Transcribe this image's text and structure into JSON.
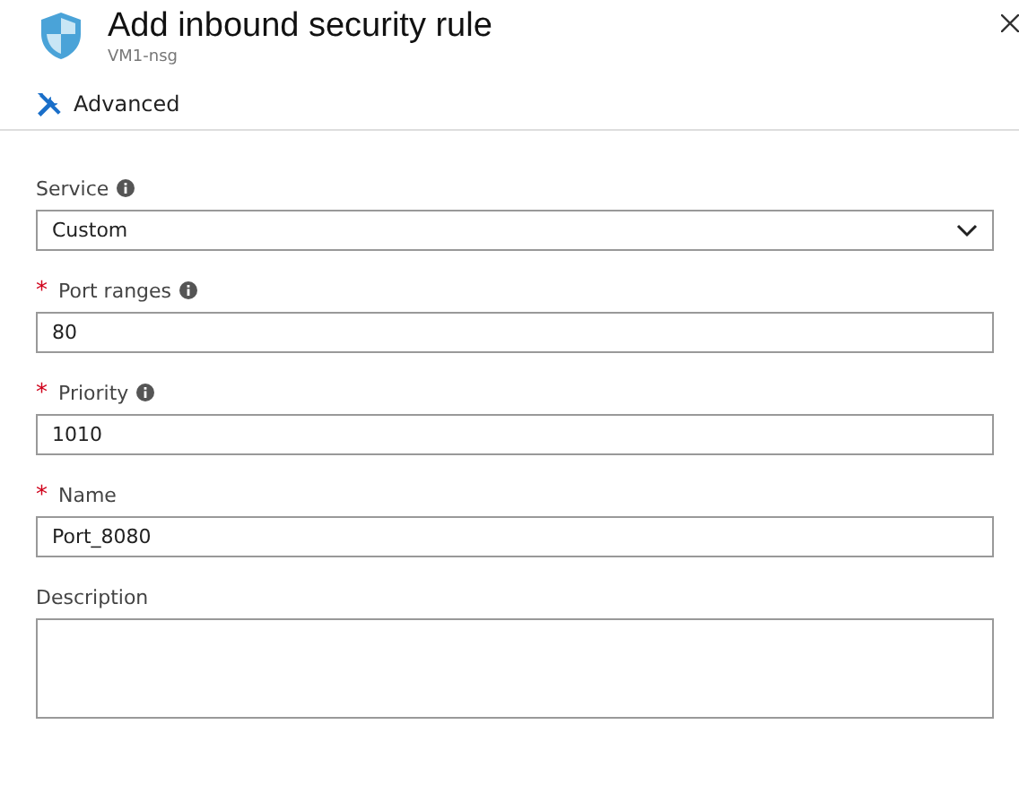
{
  "header": {
    "title": "Add inbound security rule",
    "subtitle": "VM1-nsg"
  },
  "toolbar": {
    "label": "Advanced"
  },
  "fields": [
    {
      "kind": "select",
      "label": "Service",
      "info": true,
      "value": "Custom"
    },
    {
      "kind": "text",
      "label": "Port ranges",
      "required_mark": "*",
      "info": true,
      "value": "80"
    },
    {
      "kind": "text",
      "label": "Priority",
      "required_mark": "*",
      "info": true,
      "value": "1010"
    },
    {
      "kind": "text",
      "label": "Name",
      "required_mark": "*",
      "info": false,
      "value": "Port_8080"
    },
    {
      "kind": "textarea",
      "label": "Description",
      "info": false
    }
  ]
}
